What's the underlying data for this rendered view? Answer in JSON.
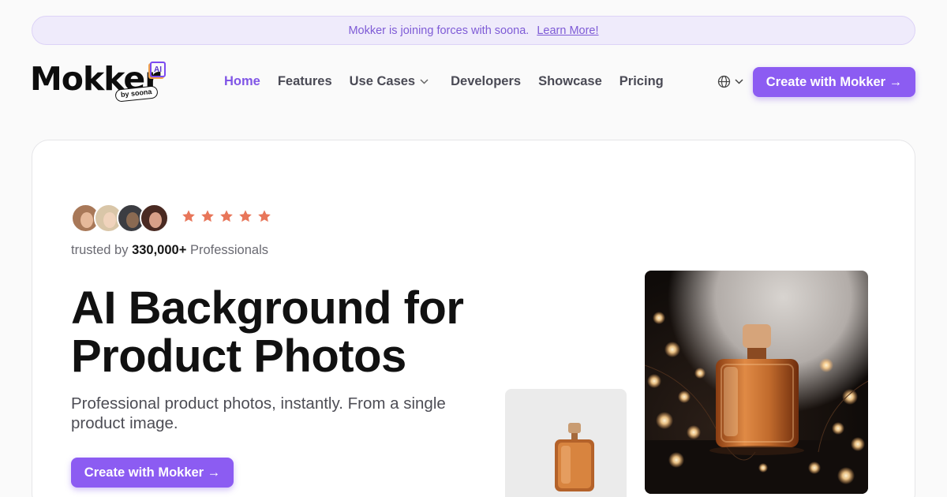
{
  "banner": {
    "text": "Mokker is joining forces with soona.",
    "link": "Learn More!"
  },
  "brand": {
    "name": "Mokker",
    "badge": "AI",
    "tagline": "by soona",
    "accent_color": "#8c5cf2"
  },
  "nav": {
    "items": [
      {
        "label": "Home",
        "active": true
      },
      {
        "label": "Features"
      },
      {
        "label": "Use Cases",
        "has_dropdown": true
      },
      {
        "label": "Developers"
      },
      {
        "label": "Showcase"
      },
      {
        "label": "Pricing"
      }
    ],
    "language_icon": "globe-icon",
    "cta": "Create with Mokker →"
  },
  "hero": {
    "rating": 5,
    "rating_icon": "star-icon",
    "star_color": "#e8765a",
    "trusted_prefix": "trusted by",
    "trusted_count": "330,000+",
    "trusted_suffix": "Professionals",
    "headline_line1": "AI Background for",
    "headline_line2": "Product Photos",
    "subheadline": "Professional product photos, instantly. From a single product image.",
    "cta": "Create with Mokker →"
  }
}
